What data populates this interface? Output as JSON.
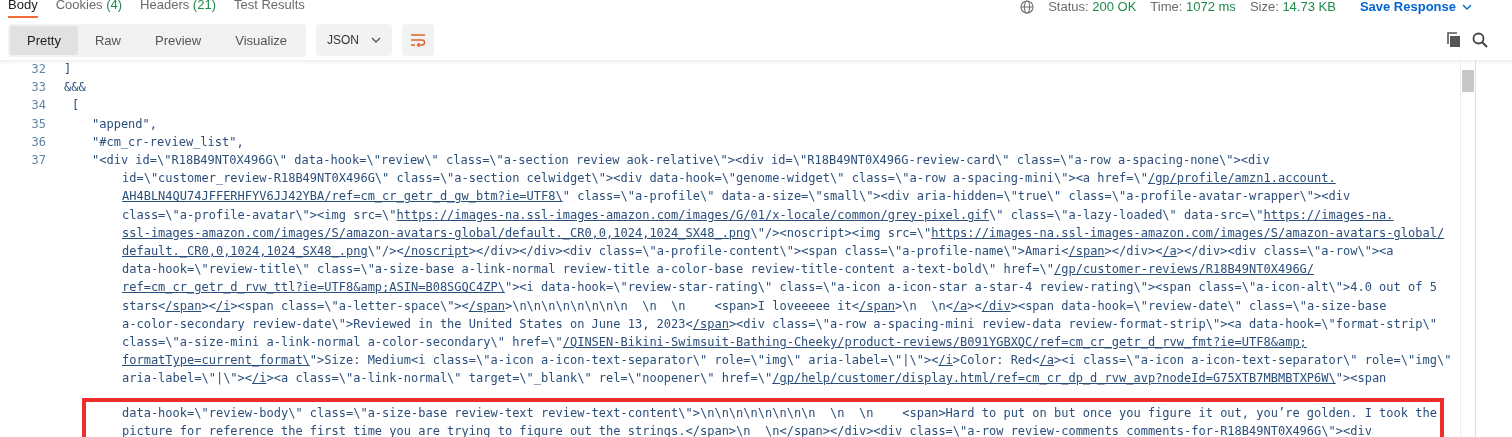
{
  "tabs": [
    {
      "label": "Body",
      "selected": true
    },
    {
      "label": "Cookies",
      "count": "(4)",
      "selected": false
    },
    {
      "label": "Headers",
      "count": "(21)",
      "selected": false
    },
    {
      "label": "Test Results",
      "selected": false
    }
  ],
  "status": [
    {
      "label": "Status:",
      "value": "200 OK"
    },
    {
      "label": "Time:",
      "value": "1072 ms"
    },
    {
      "label": "Size:",
      "value": "14.73 KB"
    }
  ],
  "save_response": "Save Response",
  "view_modes": [
    {
      "label": "Pretty",
      "selected": true
    },
    {
      "label": "Raw",
      "selected": false
    },
    {
      "label": "Preview",
      "selected": false
    },
    {
      "label": "Visualize",
      "selected": false
    }
  ],
  "format": "JSON",
  "code": {
    "lines": [
      {
        "number": "32",
        "text": "]"
      },
      {
        "number": "33",
        "text": "&&&",
        "children": [
          {
            "number": "34",
            "text": "[",
            "children": [
              {
                "number": "35",
                "text": "\"append\","
              },
              {
                "number": "36",
                "text": "\"#cm_cr-review_list\","
              },
              {
                "number": "37",
                "wrapped_lines": [
                  [
                    {
                      "text": "\"<div id=\\\"R18B49NT0X496G\\\" data-hook=\\\"review\\\" class=\\\"a-section review aok-relative\\\"><div id=\\\"R18B49NT0X496G-review-card\\\" class=\\\"a-row a-spacing-none\\\"><div",
                      "link": false
                    }
                  ],
                  [
                    {
                      "text": "id=\\\"customer_review-R18B49NT0X496G\\\" class=\\\"a-section celwidget\\\"><div data-hook=\\\"genome-widget\\\" class=\\\"a-row a-spacing-mini\\\"><a href=\\\"",
                      "link": false
                    },
                    {
                      "text": "/gp/profile/amzn1.account.",
                      "link": true
                    }
                  ],
                  [
                    {
                      "text": "AH4BLN4QU74JFFERHFYV6JJ42YBA/ref=cm_cr_getr_d_gw_btm?ie=UTF8\\",
                      "link": true
                    },
                    {
                      "text": "\" class=\\\"a-profile\\\" data-a-size=\\\"small\\\"><div aria-hidden=\\\"true\\\" class=\\\"a-profile-avatar-wrapper\\\"><div",
                      "link": false
                    }
                  ],
                  [
                    {
                      "text": "class=\\\"a-profile-avatar\\\"><img src=\\\"",
                      "link": false
                    },
                    {
                      "text": "https://images-na.ssl-images-amazon.com/images/G/01/x-locale/common/grey-pixel.gif",
                      "link": true
                    },
                    {
                      "text": "\\\" class=\\\"a-lazy-loaded\\\" data-src=\\\"",
                      "link": false
                    },
                    {
                      "text": "https://images-na.",
                      "link": true
                    }
                  ],
                  [
                    {
                      "text": "ssl-images-amazon.com/images/S/amazon-avatars-global/default._CR0,0,1024,1024_SX48_.png",
                      "link": true
                    },
                    {
                      "text": "\\\"/><noscript><img src=\\\"",
                      "link": false
                    },
                    {
                      "text": "https://images-na.ssl-images-amazon.com/images/S/amazon-avatars-global/",
                      "link": true
                    }
                  ],
                  [
                    {
                      "text": "default._CR0,0,1024,1024_SX48_.png",
                      "link": true
                    },
                    {
                      "text": "\\\"/><",
                      "link": false
                    },
                    {
                      "text": "/noscript",
                      "link": true
                    },
                    {
                      "text": "></div></div><div class=\\\"a-profile-content\\\"><span class=\\\"a-profile-name\\\">Amari<",
                      "link": false
                    },
                    {
                      "text": "/span",
                      "link": true
                    },
                    {
                      "text": "></div><",
                      "link": false
                    },
                    {
                      "text": "/a",
                      "link": true
                    },
                    {
                      "text": "></div><div class=\\\"a-row\\\"><a",
                      "link": false
                    }
                  ],
                  [
                    {
                      "text": "data-hook=\\\"review-title\\\" class=\\\"a-size-base a-link-normal review-title a-color-base review-title-content a-text-bold\\\" href=\\\"",
                      "link": false
                    },
                    {
                      "text": "/gp/customer-reviews/R18B49NT0X496G/",
                      "link": true
                    }
                  ],
                  [
                    {
                      "text": "ref=cm_cr_getr_d_rvw_ttl?ie=UTF8&amp;ASIN=B08SGQC4ZP\\",
                      "link": true
                    },
                    {
                      "text": "\"><i data-hook=\\\"review-star-rating\\\" class=\\\"a-icon a-icon-star a-star-4 review-rating\\\"><span class=\\\"a-icon-alt\\\">4.0 out of 5",
                      "link": false
                    }
                  ],
                  [
                    {
                      "text": "stars<",
                      "link": false
                    },
                    {
                      "text": "/span",
                      "link": true
                    },
                    {
                      "text": "><",
                      "link": false
                    },
                    {
                      "text": "/i",
                      "link": true
                    },
                    {
                      "text": "><span class=\\\"a-letter-space\\\"><",
                      "link": false
                    },
                    {
                      "text": "/span",
                      "link": true
                    },
                    {
                      "text": ">\\n\\n\\n\\n\\n\\n\\n\\n  \\n  \\n    <span>I loveeeee it<",
                      "link": false
                    },
                    {
                      "text": "/span",
                      "link": true
                    },
                    {
                      "text": ">\\n  \\n<",
                      "link": false
                    },
                    {
                      "text": "/a",
                      "link": true
                    },
                    {
                      "text": "><",
                      "link": false
                    },
                    {
                      "text": "/div",
                      "link": true
                    },
                    {
                      "text": "><span data-hook=\\\"review-date\\\" class=\\\"a-size-base",
                      "link": false
                    }
                  ],
                  [
                    {
                      "text": "a-color-secondary review-date\\\">Reviewed in the United States on June 13, 2023<",
                      "link": false
                    },
                    {
                      "text": "/span",
                      "link": true
                    },
                    {
                      "text": "><div class=\\\"a-row a-spacing-mini review-data review-format-strip\\\"><a data-hook=\\\"format-strip\\\"",
                      "link": false
                    }
                  ],
                  [
                    {
                      "text": "class=\\\"a-size-mini a-link-normal a-color-secondary\\\" href=\\\"",
                      "link": false
                    },
                    {
                      "text": "/QINSEN-Bikini-Swimsuit-Bathing-Cheeky/product-reviews/B091YGBXQC/ref=cm_cr_getr_d_rvw_fmt?ie=UTF8&amp;",
                      "link": true
                    }
                  ],
                  [
                    {
                      "text": "formatType=current_format\\",
                      "link": true
                    },
                    {
                      "text": "\">Size: Medium<i class=\\\"a-icon a-icon-text-separator\\\" role=\\\"img\\\" aria-label=\\\"|\\\"><",
                      "link": false
                    },
                    {
                      "text": "/i",
                      "link": true
                    },
                    {
                      "text": ">Color: Red<",
                      "link": false
                    },
                    {
                      "text": "/a",
                      "link": true
                    },
                    {
                      "text": "><i class=\\\"a-icon a-icon-text-separator\\\" role=\\\"img\\\"",
                      "link": false
                    }
                  ],
                  [
                    {
                      "text": "aria-label=\\\"|\\\"><",
                      "link": false
                    },
                    {
                      "text": "/i",
                      "link": true
                    },
                    {
                      "text": "><a class=\\\"a-link-normal\\\" target=\\\"_blank\\\" rel=\\\"noopener\\\" href=\\\"",
                      "link": false
                    },
                    {
                      "text": "/gp/help/customer/display.html/ref=cm_cr_dp_d_rvw_avp?nodeId=G75XTB7MBMBTXP6W\\",
                      "link": true
                    },
                    {
                      "text": "\"><span",
                      "link": false
                    }
                  ]
                ],
                "highlighted_wrapped_lines": [
                  [
                    {
                      "text": "data-hook=\\\"review-body\\\" class=\\\"a-size-base review-text review-text-content\\\">\\n\\n\\n\\n\\n\\n\\n\\n  \\n  \\n    <span>Hard to put on but once you figure it out, you’re golden. I took the",
                      "link": false
                    }
                  ],
                  [
                    {
                      "text": "picture for reference the first time you are trying to figure out the strings.</span>\\n  \\n</span></div><div class=\\\"a-row review-comments comments-for-R18B49NT0X496G\\\"><div",
                      "link": false
                    }
                  ]
                ]
              }
            ]
          }
        ]
      }
    ]
  }
}
